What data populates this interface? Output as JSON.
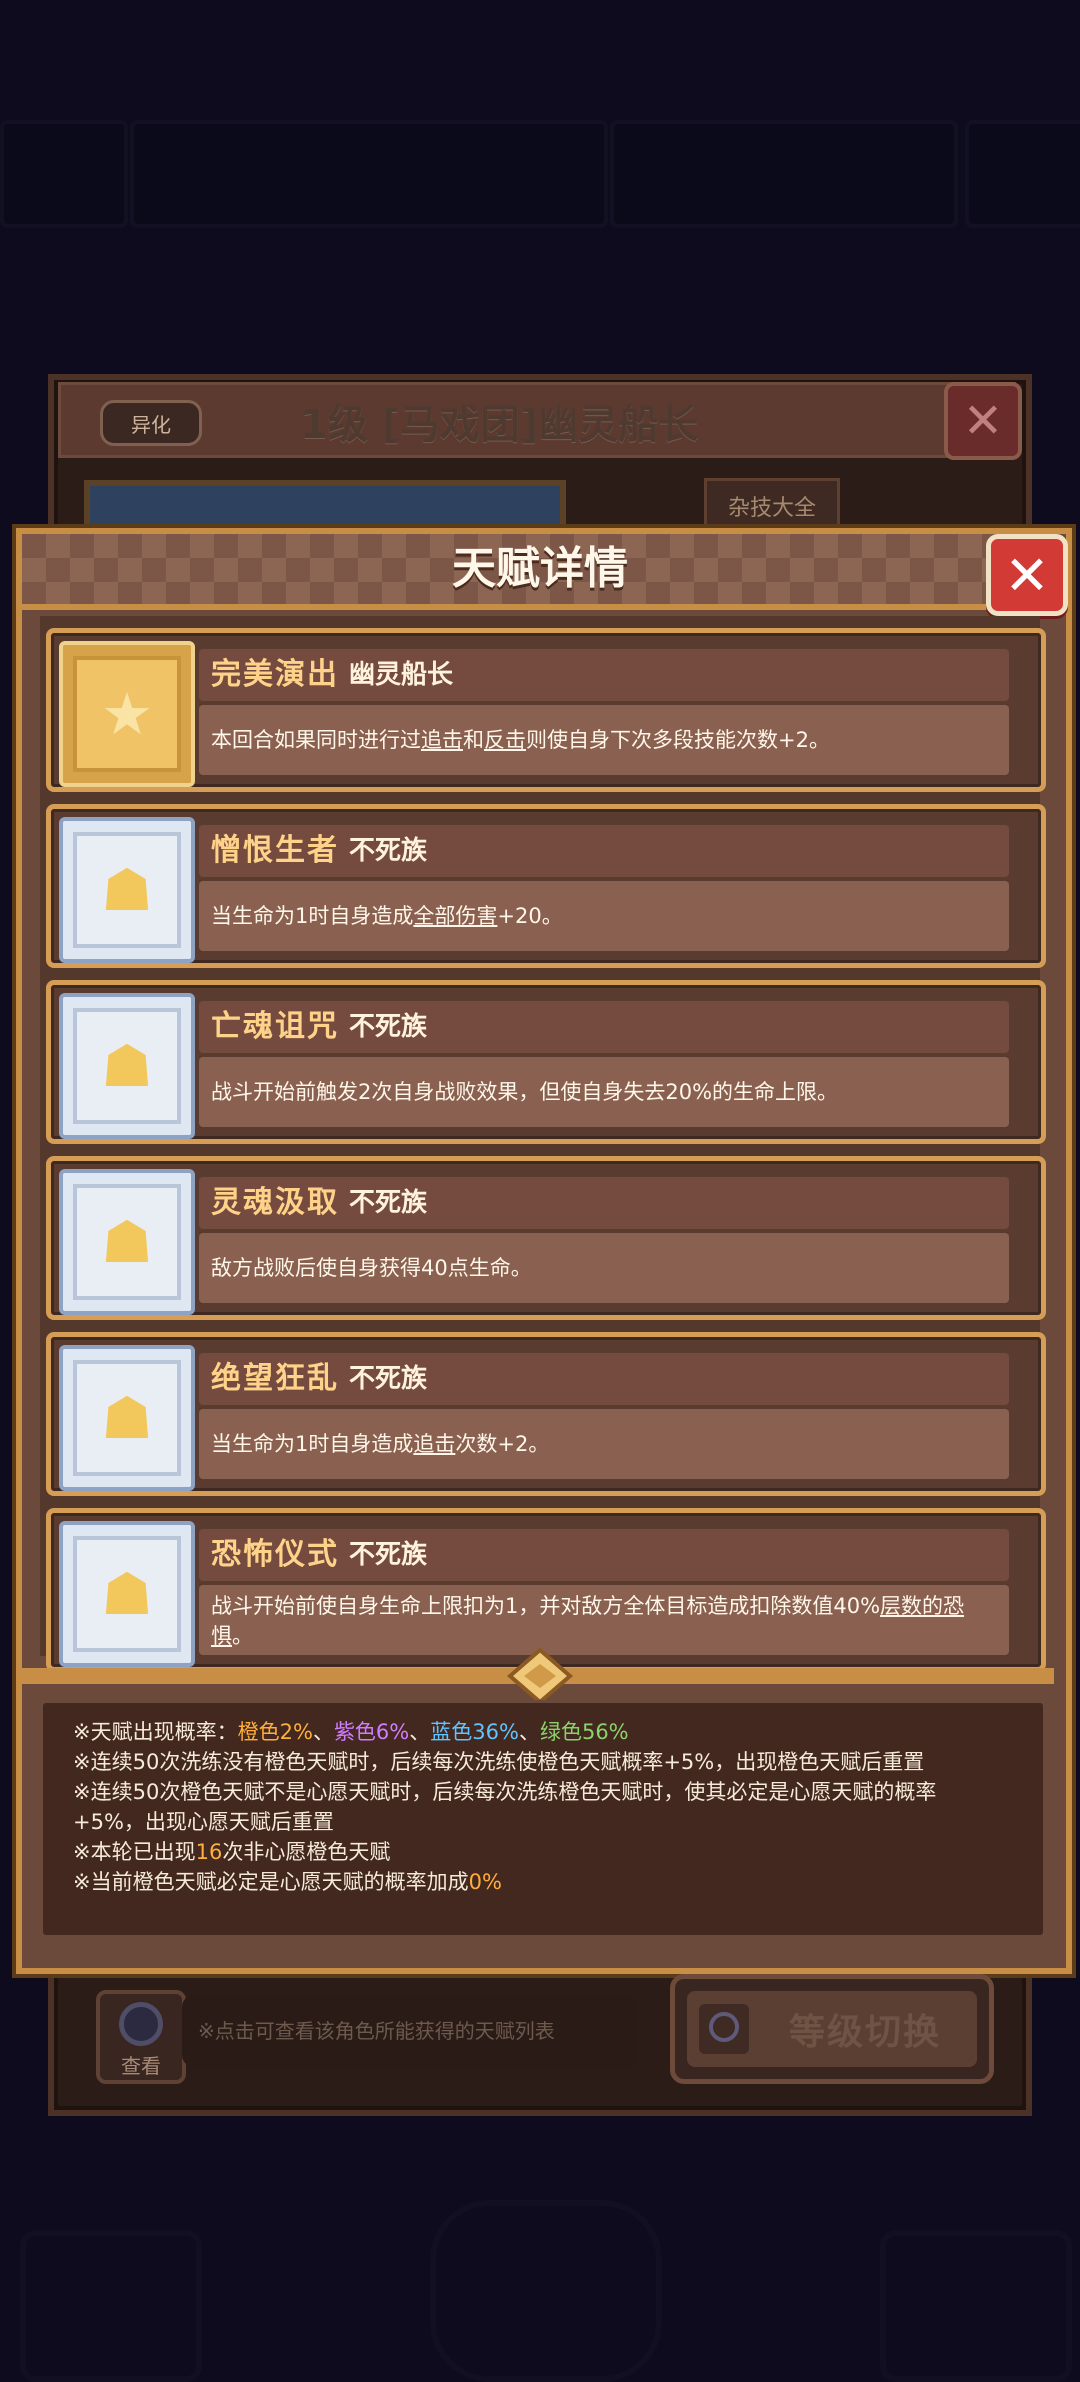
{
  "background": {
    "badge": "异化",
    "character_title": "1级 [马戏团]幽灵船长",
    "tag": "杂技大全",
    "search_label": "查看",
    "hint": "※点击可查看该角色所能获得的天赋列表",
    "level_switch": "等级切换"
  },
  "modal": {
    "title": "天赋详情",
    "close_icon": "close-icon",
    "talents": [
      {
        "name": "完美演出",
        "tribe": "幽灵船长",
        "frame": "gold",
        "icon": "★",
        "desc_parts": [
          "本回合如果同时进行过",
          "追击",
          "和",
          "反击",
          "则使自身下次多段技能次数+2。"
        ]
      },
      {
        "name": "憎恨生者",
        "tribe": "不死族",
        "frame": "silver",
        "icon": "☗",
        "desc_parts": [
          "当生命为1时自身造成",
          "全部伤害",
          "+20。"
        ]
      },
      {
        "name": "亡魂诅咒",
        "tribe": "不死族",
        "frame": "silver",
        "icon": "☗",
        "desc_parts": [
          "战斗开始前触发2次自身战败效果，但使自身失去20%的生命上限。"
        ]
      },
      {
        "name": "灵魂汲取",
        "tribe": "不死族",
        "frame": "silver",
        "icon": "☗",
        "desc_parts": [
          "敌方战败后使自身获得40点生命。"
        ]
      },
      {
        "name": "绝望狂乱",
        "tribe": "不死族",
        "frame": "silver",
        "icon": "☗",
        "desc_parts": [
          "当生命为1时自身造成",
          "追击",
          "次数+2。"
        ]
      },
      {
        "name": "恐怖仪式",
        "tribe": "不死族",
        "frame": "silver",
        "icon": "☗",
        "desc_parts": [
          "战斗开始前使自身生命上限扣为1，并对敌方全体目标造成扣除数值",
          "40%",
          "层数的恐惧",
          "。"
        ]
      }
    ]
  },
  "rates": {
    "line1_prefix": "※天赋出现概率：",
    "orange": "橙色2%",
    "sep1": "、",
    "purple": "紫色6%",
    "sep2": "、",
    "blue": "蓝色36%",
    "sep3": "、",
    "green": "绿色56%",
    "line2": "※连续50次洗练没有橙色天赋时，后续每次洗练使橙色天赋概率+5%，出现橙色天赋后重置",
    "line3a": "※连续50次橙色天赋不是心愿天赋时，后续每次洗练橙色天赋时，使其必定是心愿天赋的概率",
    "line3b": "+5%，出现心愿天赋后重置",
    "line4_prefix": "※本轮已出现",
    "line4_count": "16",
    "line4_suffix": "次非心愿橙色天赋",
    "line5_prefix": "※当前橙色天赋必定是心愿天赋的概率加成",
    "line5_value": "0%"
  }
}
